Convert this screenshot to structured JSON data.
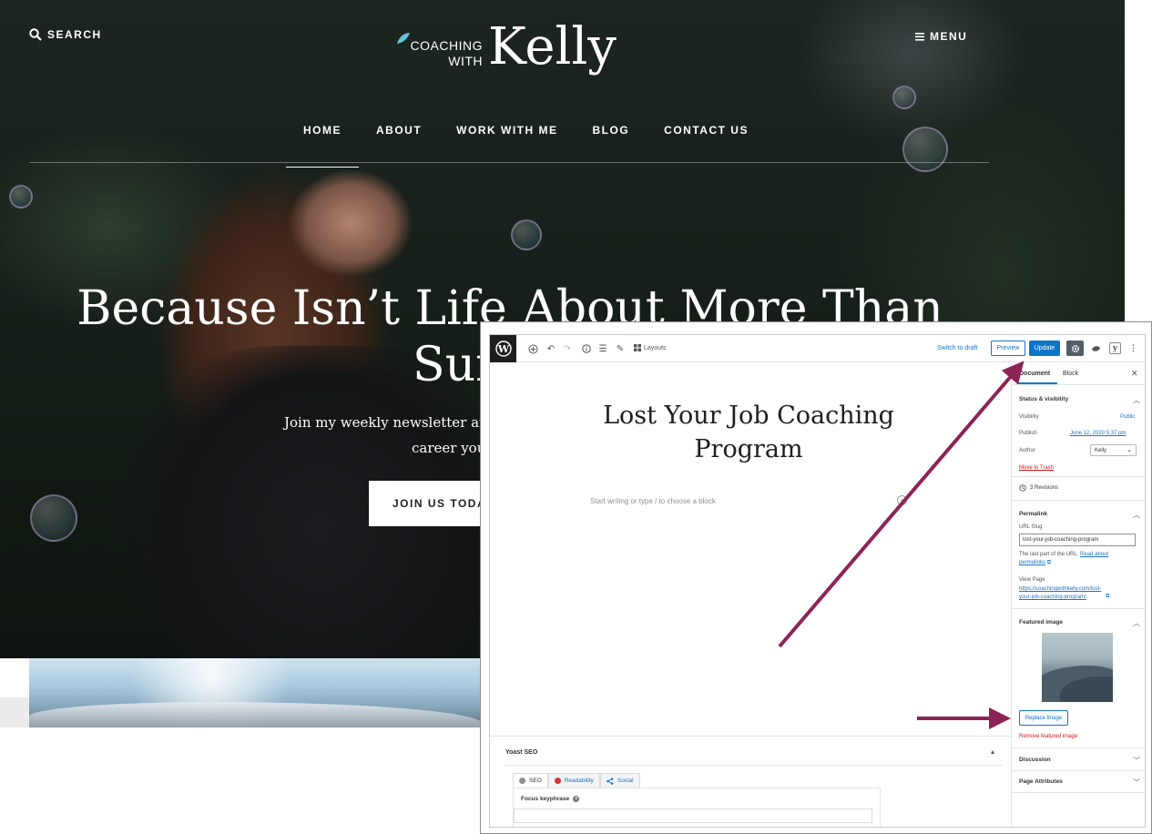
{
  "site": {
    "search_label": "SEARCH",
    "menu_label": "MENU",
    "logo": {
      "line1": "COACHING",
      "line2": "WITH",
      "name": "Kelly"
    },
    "nav": [
      "HOME",
      "ABOUT",
      "WORK WITH ME",
      "BLOG",
      "CONTACT US"
    ],
    "nav_active": "HOME",
    "hero_title_line1": "Because Isn’t Life About More Than",
    "hero_title_line2": "Sur",
    "hero_sub_line1": "Join my weekly newsletter and g",
    "hero_sub_line2": "career you",
    "join_button": "JOIN US TODAY"
  },
  "editor": {
    "toolbar": {
      "layouts_label": "Layouts",
      "switch_to_draft": "Switch to draft",
      "preview": "Preview",
      "update": "Update"
    },
    "post_title": "Lost Your Job Coaching Program",
    "block_placeholder": "Start writing or type / to choose a block",
    "sidebar": {
      "tab_document": "Document",
      "tab_block": "Block",
      "status_visibility_heading": "Status & visibility",
      "visibility_label": "Visibility",
      "visibility_value": "Public",
      "publish_label": "Publish",
      "publish_value": "June 12, 2020 5:37 pm",
      "author_label": "Author",
      "author_value": "Kelly",
      "move_to_trash": "Move to Trash",
      "revisions": "3 Revisions",
      "permalink_heading": "Permalink",
      "url_slug_label": "URL Slug",
      "url_slug_value": "lost-your-job-coaching-program",
      "slug_note": "The last part of the URL.",
      "read_about_link": "Read about",
      "permalinks_link": "permalinks",
      "view_page_label": "View Page",
      "view_page_link_line1": "https://coachingwithkelly.com/lost-",
      "view_page_link_line2": "your-job-coaching-program/",
      "featured_image_heading": "Featured image",
      "replace_image": "Replace Image",
      "remove_featured_image": "Remove featured image",
      "discussion_heading": "Discussion",
      "page_attributes_heading": "Page Attributes"
    },
    "yoast": {
      "title": "Yoast SEO",
      "tabs": [
        {
          "label": "SEO",
          "dot_color": "#8a8f94"
        },
        {
          "label": "Readability",
          "dot_color": "#dc3232"
        },
        {
          "label": "Social",
          "dot_color": "#1a73c6"
        }
      ],
      "focus_keyphrase_label": "Focus keyphrase"
    }
  },
  "colors": {
    "accent_blue": "#0d75c8",
    "arrow_color": "#8c2456",
    "trash_red": "#cc1818",
    "logo_leaf": "#5fc4d4"
  }
}
